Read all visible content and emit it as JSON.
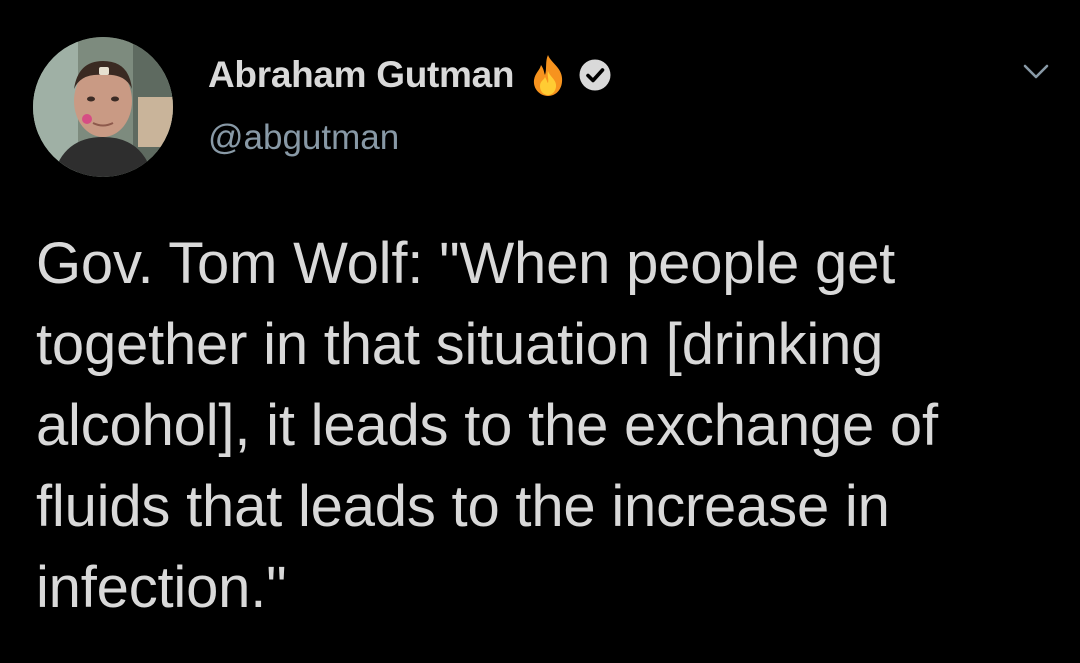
{
  "author": {
    "display_name": "Abraham Gutman",
    "handle": "@abgutman",
    "name_emoji_icon": "fire-emoji-icon",
    "verified_icon": "verified-badge-icon",
    "avatar_icon": "profile-photo"
  },
  "menu": {
    "icon": "chevron-down-icon"
  },
  "tweet": {
    "text": "Gov. Tom Wolf: \"When people get together in that situation [drinking alcohol], it leads to the exchange of fluids that leads to the increase in infection.\""
  },
  "colors": {
    "background": "#000000",
    "text": "#d9d9d9",
    "secondary_text": "#8899a6"
  }
}
